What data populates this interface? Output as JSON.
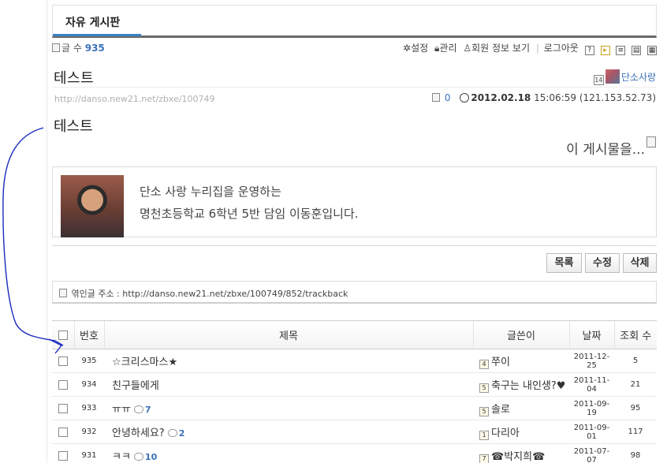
{
  "board": {
    "title": "자유 게시판"
  },
  "meta": {
    "post_count_label": "글 수",
    "post_count": "935",
    "settings": "설정",
    "manage": "관리",
    "member_info": "회원 정보 보기",
    "logout": "로그아웃",
    "help_glyph": "?"
  },
  "post": {
    "title": "테스트",
    "author": "단소사랑",
    "author_level": "14",
    "url": "http://danso.new21.net/zbxe/100749",
    "comment_count": "0",
    "date": "2012.02.18",
    "time": "15:06:59",
    "ip": "(121.153.52.73)",
    "body_line1": "테스트",
    "body_line2": "이 게시물을...",
    "profile_line1": "단소 사랑 누리집을 운영하는",
    "profile_line2": "명천초등학교 6학년 5반 담임 이동훈입니다."
  },
  "actions": {
    "list": "목록",
    "edit": "수정",
    "delete": "삭제"
  },
  "trackback": {
    "label": "엮인글 주소 : ",
    "url": "http://danso.new21.net/zbxe/100749/852/trackback"
  },
  "list": {
    "headers": {
      "number": "번호",
      "title": "제목",
      "author": "글쓴이",
      "date": "날짜",
      "views": "조회 수"
    },
    "rows": [
      {
        "number": "935",
        "title": "☆크리스마스★",
        "comments": "",
        "author": "쭈이",
        "level": "4",
        "date": "2011-12-25",
        "views": "5"
      },
      {
        "number": "934",
        "title": "친구들에게",
        "comments": "",
        "author": "축구는 내인생?♥",
        "level": "5",
        "date": "2011-11-04",
        "views": "21"
      },
      {
        "number": "933",
        "title": "ㅠㅠ",
        "comments": "7",
        "author": "솔로",
        "level": "5",
        "date": "2011-09-19",
        "views": "95"
      },
      {
        "number": "932",
        "title": "안녕하세요?",
        "comments": "2",
        "author": "다리아",
        "level": "1",
        "date": "2011-09-01",
        "views": "117"
      },
      {
        "number": "931",
        "title": "ㅋㅋ",
        "comments": "10",
        "author": "☎박지희☎",
        "level": "7",
        "date": "2011-07-07",
        "views": "98"
      }
    ]
  },
  "colors": {
    "accent": "#3a72b8",
    "annotation": "#1a2bbf",
    "tab_underline": "#3b82c4"
  }
}
